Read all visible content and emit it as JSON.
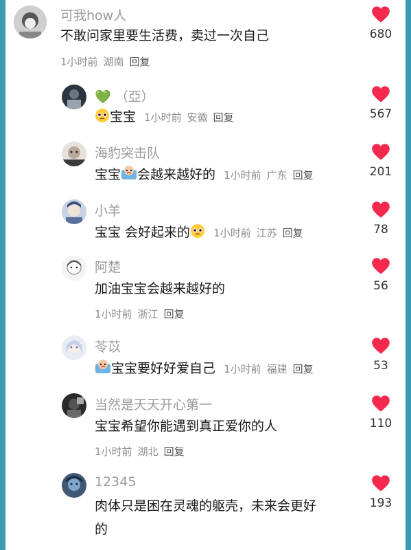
{
  "comments": [
    {
      "username": "可我how人",
      "text": "不敢问家里要生活费，卖过一次自己",
      "time": "1小时前",
      "location": "湖南",
      "reply": "回复",
      "likes": "680"
    },
    {
      "username": "💚 （亞）",
      "text": "宝宝",
      "time": "1小时前",
      "location": "安徽",
      "reply": "回复",
      "likes": "567"
    },
    {
      "username": "海豹突击队",
      "text": "宝宝",
      "text2": "会越来越好的",
      "time": "1小时前",
      "location": "广东",
      "reply": "回复",
      "likes": "201"
    },
    {
      "username": "小羊",
      "text": "宝宝 会好起来的",
      "time": "1小时前",
      "location": "江苏",
      "reply": "回复",
      "likes": "78"
    },
    {
      "username": "阿楚",
      "text": "加油宝宝会越来越好的",
      "time": "1小时前",
      "location": "浙江",
      "reply": "回复",
      "likes": "56"
    },
    {
      "username": "苓苡",
      "text": "宝宝要好好爱自己",
      "time": "1小时前",
      "location": "福建",
      "reply": "回复",
      "likes": "53"
    },
    {
      "username": "当然是天天开心第一",
      "text": "宝宝希望你能遇到真正爱你的人",
      "time": "1小时前",
      "location": "湖北",
      "reply": "回复",
      "likes": "110"
    },
    {
      "username": "12345",
      "text": "肉体只是困在灵魂的躯壳，未来会更好",
      "text2": "的",
      "likes": "193"
    }
  ],
  "icons": {
    "like": "heart-icon",
    "emoji_pleading": "pleading-face-emoji",
    "emoji_crying": "crying-sticker-emoji"
  },
  "colors": {
    "heart": "#f5294d",
    "username": "#9a9a9a",
    "meta": "#8c8c8c",
    "border": "#3a9bb0"
  }
}
